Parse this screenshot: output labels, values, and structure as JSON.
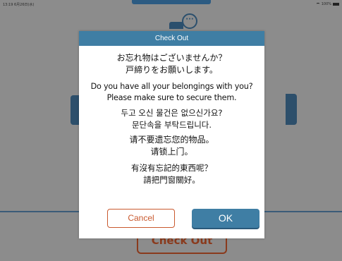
{
  "status_bar": {
    "time": "13:19  6月26日(水)",
    "battery": "100%"
  },
  "background": {
    "checkout_label": "Check Out"
  },
  "dialog": {
    "title": "Check Out",
    "message_ja": [
      "お忘れ物はございませんか？",
      "戸締りをお願いします。"
    ],
    "message_en": [
      "Do you have all your belongings with you?",
      "Please make sure to secure them."
    ],
    "message_ko": [
      "두고 오신 물건은 없으신가요?",
      "문단속을 부탁드립니다."
    ],
    "message_zh": [
      "请不要遗忘您的物品。",
      "请锁上门。"
    ],
    "message_tw": [
      "有沒有忘記的東西呢？",
      "請把門窗關好。"
    ],
    "cancel_label": "Cancel",
    "ok_label": "OK"
  },
  "colors": {
    "accent": "#3f7ea4",
    "cancel": "#c9592e"
  }
}
